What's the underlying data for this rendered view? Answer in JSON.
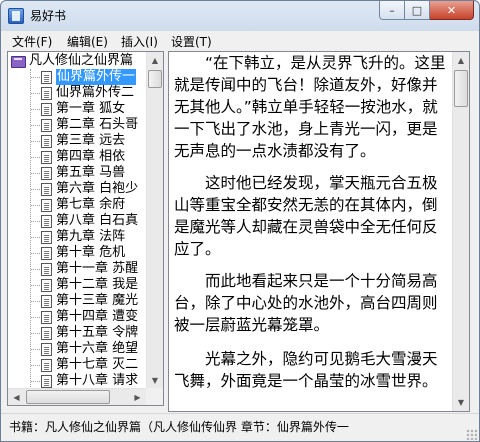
{
  "window": {
    "title": "易好书",
    "icon": "book-app-icon",
    "controls": {
      "minimize": "–",
      "maximize": "□",
      "close": "✕"
    }
  },
  "menu": [
    {
      "label": "文件(F)"
    },
    {
      "label": "编辑(E)"
    },
    {
      "label": "插入(I)"
    },
    {
      "label": "设置(T)"
    }
  ],
  "tree": {
    "root": "凡人修仙之仙界篇",
    "items": [
      "仙界篇外传一",
      "仙界篇外传二",
      "第一章 狐女",
      "第二章 石头哥",
      "第三章 远去",
      "第四章 相依",
      "第五章 马兽",
      "第六章 白袍少",
      "第七章 余府",
      "第八章 白石真",
      "第九章 法阵",
      "第十章 危机",
      "第十一章 苏醒",
      "第十二章 我是",
      "第十三章 魔光",
      "第十四章 遭变",
      "第十五章 令牌",
      "第十六章 绝望",
      "第十七章 灭二",
      "第十八章 请求",
      "第十九章 化神"
    ],
    "selected_index": 0
  },
  "content": {
    "paragraphs": [
      "“在下韩立，是从灵界飞升的。这里就是传闻中的飞台！除道友外，好像并无其他人。”韩立单手轻轻一按池水，就一下飞出了水池，身上青光一闪，更是无声息的一点水渍都没有了。",
      "这时他已经发现，掌天瓶元合五极山等重宝全都安然无恙的在其体内，倒是魔光等人却藏在灵兽袋中全无任何反应了。",
      "而此地看起来只是一个十分简易高台，除了中心处的水池外，高台四周则被一层蔚蓝光幕笼罩。",
      "光幕之外，隐约可见鹅毛大雪漫天飞舞，外面竟是一个晶莹的冰雪世界。"
    ]
  },
  "status": {
    "text": "书籍：凡人修仙之仙界篇（凡人修仙传仙界 章节：仙界篇外传一"
  },
  "scroll": {
    "tree_vertical_position": 0.0,
    "content_vertical_position": 0.0
  }
}
